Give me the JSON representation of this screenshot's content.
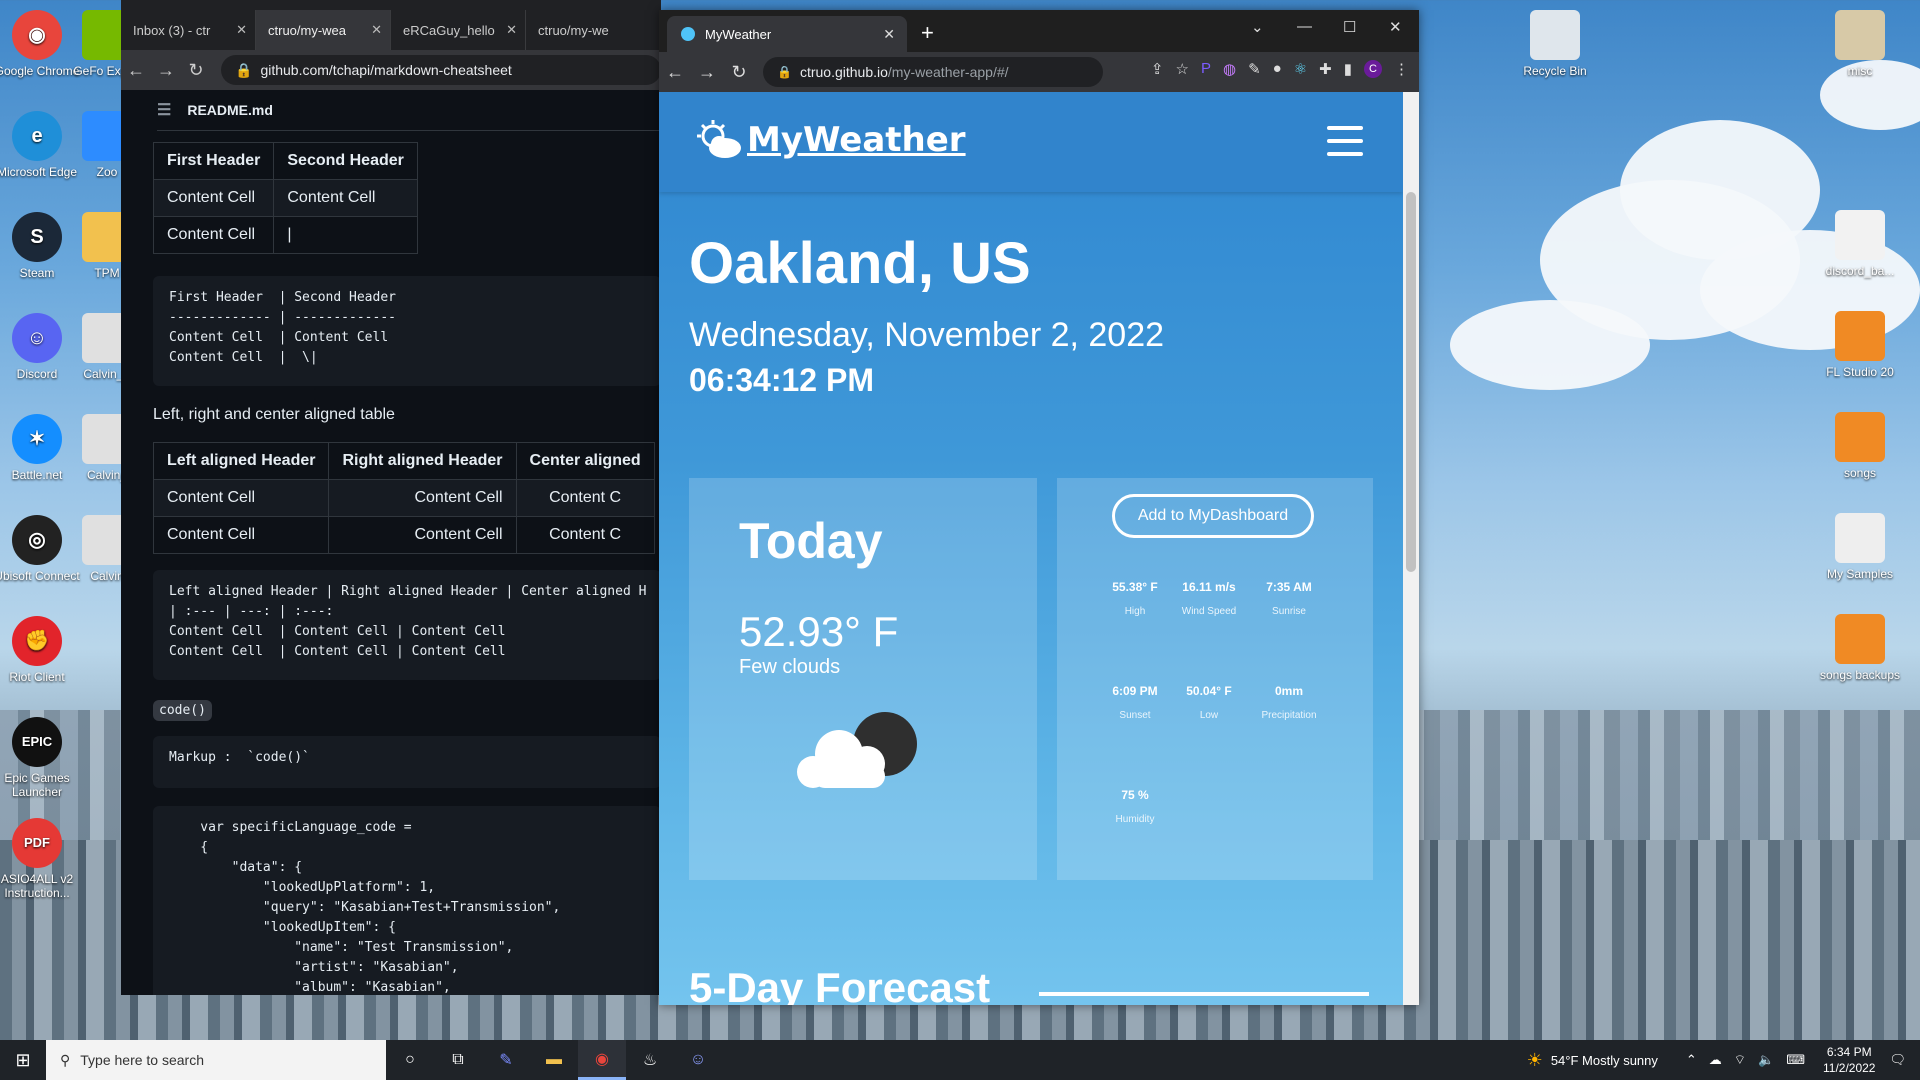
{
  "desktop": {
    "left_icons": [
      {
        "label": "Google Chrome",
        "color": "#e8453c",
        "glyph": "◉"
      },
      {
        "label": "Microsoft Edge",
        "color": "#1f8fd8",
        "glyph": "e"
      },
      {
        "label": "Steam",
        "color": "#1b2838",
        "glyph": "S"
      },
      {
        "label": "Discord",
        "color": "#5865f2",
        "glyph": "☺"
      },
      {
        "label": "Battle.net",
        "color": "#148eff",
        "glyph": "✶"
      },
      {
        "label": "Ubisoft Connect",
        "color": "#222",
        "glyph": "◎"
      },
      {
        "label": "Riot Client",
        "color": "#e2242b",
        "glyph": "✊"
      },
      {
        "label": "Epic Games Launcher",
        "color": "#111",
        "glyph": "EPIC"
      },
      {
        "label": "ASIO4ALL v2 Instruction...",
        "color": "#e53935",
        "glyph": "PDF"
      }
    ],
    "col2_icons": [
      {
        "label": "GeFo Experi",
        "color": "#76b900"
      },
      {
        "label": "Zoo",
        "color": "#2d8cff"
      },
      {
        "label": "TPM",
        "color": "#f2c14e"
      },
      {
        "label": "Calvin_T",
        "color": "#e0e0e0"
      },
      {
        "label": "Calvin_",
        "color": "#e0e0e0"
      },
      {
        "label": "Calvin",
        "color": "#e0e0e0"
      }
    ],
    "right_icons": [
      {
        "label": "Recycle Bin",
        "color": "#dfe6ec"
      },
      {
        "label": "misc",
        "color": "#d7c9a7"
      },
      {
        "label": "discord_ba...",
        "color": "#f2f2f2"
      },
      {
        "label": "FL Studio 20",
        "color": "#f08a24"
      },
      {
        "label": "songs",
        "color": "#f08a24"
      },
      {
        "label": "My Samples",
        "color": "#eeeeee"
      },
      {
        "label": "songs backups",
        "color": "#f08a24"
      }
    ]
  },
  "github_window": {
    "tabs": [
      "Inbox (3) - ctr",
      "ctruo/my-wea",
      "eRCaGuy_hello",
      "ctruo/my-we"
    ],
    "url": "github.com/tchapi/markdown-cheatsheet",
    "file": "README.md",
    "table1": {
      "headers": [
        "First Header",
        "Second Header"
      ],
      "rows": [
        [
          "Content Cell",
          "Content Cell"
        ],
        [
          "Content Cell",
          "|"
        ]
      ]
    },
    "code1": "First Header  | Second Header\n------------- | -------------\nContent Cell  | Content Cell\nContent Cell  |  \\|",
    "para": "Left, right and center aligned table",
    "table2": {
      "headers": [
        "Left aligned Header",
        "Right aligned Header",
        "Center aligned"
      ],
      "rows": [
        [
          "Content Cell",
          "Content Cell",
          "Content C"
        ],
        [
          "Content Cell",
          "Content Cell",
          "Content C"
        ]
      ]
    },
    "code2": "Left aligned Header | Right aligned Header | Center aligned H\n| :--- | ---: | :---:\nContent Cell  | Content Cell | Content Cell\nContent Cell  | Content Cell | Content Cell",
    "inline_code": "code()",
    "code3": "Markup :  `code()`",
    "code4": "    var specificLanguage_code =\n    {\n        \"data\": {\n            \"lookedUpPlatform\": 1,\n            \"query\": \"Kasabian+Test+Transmission\",\n            \"lookedUpItem\": {\n                \"name\": \"Test Transmission\",\n                \"artist\": \"Kasabian\",\n                \"album\": \"Kasabian\","
  },
  "weather_window": {
    "tab_title": "MyWeather",
    "url_host": "ctruo.github.io",
    "url_path": "/my-weather-app/#/",
    "logo": "MyWeather",
    "city": "Oakland, US",
    "date": "Wednesday, November 2, 2022",
    "time": "06:34:12 PM",
    "today_label": "Today",
    "temp": "52.93° F",
    "description": "Few clouds",
    "add_button": "Add to MyDashboard",
    "stats": [
      {
        "value": "55.38° F",
        "label": "High"
      },
      {
        "value": "16.11 m/s",
        "label": "Wind Speed"
      },
      {
        "value": "7:35 AM",
        "label": "Sunrise"
      },
      {
        "value": "6:09 PM",
        "label": "Sunset"
      },
      {
        "value": "50.04° F",
        "label": "Low"
      },
      {
        "value": "0mm",
        "label": "Precipitation"
      },
      {
        "value": "75 %",
        "label": "Humidity"
      }
    ],
    "forecast_title": "5-Day Forecast"
  },
  "taskbar": {
    "search_placeholder": "Type here to search",
    "weather": "54°F  Mostly sunny",
    "time": "6:34 PM",
    "date": "11/2/2022"
  }
}
